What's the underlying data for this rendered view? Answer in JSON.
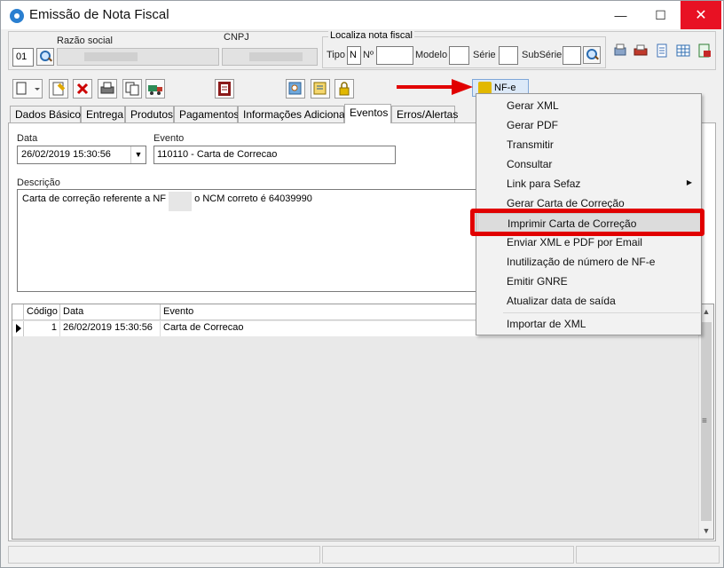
{
  "window": {
    "title": "Emissão de Nota Fiscal",
    "min_glyph": "—",
    "max_glyph": "☐",
    "close_glyph": "✕"
  },
  "header": {
    "code_value": "01",
    "razao_social_label": "Razão social",
    "cnpj_label": "CNPJ",
    "localiza": {
      "group_title": "Localiza nota fiscal",
      "tipo_label": "Tipo",
      "tipo_value": "N",
      "numero_label": "Nº",
      "modelo_label": "Modelo",
      "serie_label": "Série",
      "subserie_label": "SubSérie"
    }
  },
  "toolbar": {
    "nfe_label": "NF-e"
  },
  "tabs": [
    {
      "label": "Dados Básicos"
    },
    {
      "label": "Entrega"
    },
    {
      "label": "Produtos"
    },
    {
      "label": "Pagamentos"
    },
    {
      "label": "Informações Adicionais"
    },
    {
      "label": "Eventos"
    },
    {
      "label": "Erros/Alertas"
    }
  ],
  "eventos": {
    "data_label": "Data",
    "data_value": "26/02/2019 15:30:56",
    "evento_label": "Evento",
    "evento_value": "110110 - Carta de Correcao",
    "descricao_label": "Descrição",
    "descricao_part1": "Carta de correção referente a NF",
    "descricao_part2": "o NCM correto é 64039990"
  },
  "grid": {
    "columns": [
      "Código",
      "Data",
      "Evento"
    ],
    "rows": [
      {
        "codigo": "1",
        "data": "26/02/2019 15:30:56",
        "evento": "Carta de Correcao"
      }
    ],
    "scroll_up": "▲",
    "scroll_down": "▼",
    "grip": "≡"
  },
  "menu": {
    "items": [
      {
        "label": "Gerar XML"
      },
      {
        "label": "Gerar PDF"
      },
      {
        "label": "Transmitir"
      },
      {
        "label": "Consultar"
      },
      {
        "label": "Link para Sefaz",
        "submenu_glyph": "▶"
      },
      {
        "label": "Gerar Carta de Correção"
      },
      {
        "label": "Imprimir Carta de Correção"
      },
      {
        "label": "Enviar XML e PDF por Email"
      },
      {
        "label": "Inutilização de número de NF-e"
      },
      {
        "label": "Emitir GNRE"
      },
      {
        "label": "Atualizar data de saída"
      },
      {
        "label": "Importar de XML"
      }
    ],
    "highlighted_index": 6
  },
  "colors": {
    "annotation_red": "#e10000",
    "close_red": "#e81123"
  }
}
